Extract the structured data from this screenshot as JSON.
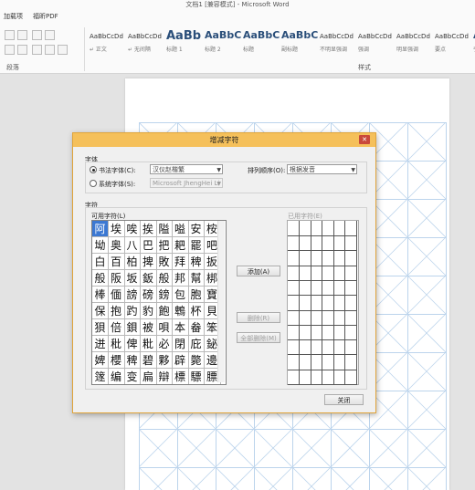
{
  "window": {
    "title": "文档1 [兼容模式] - Microsoft Word"
  },
  "ribbon": {
    "tabs": [
      "加载项",
      "福昕PDF"
    ],
    "groups": {
      "paragraph": "段落",
      "styles": "样式"
    },
    "styles": [
      {
        "preview": "AaBbCcDd",
        "name": "↵ 正文"
      },
      {
        "preview": "AaBbCcDd",
        "name": "↵ 无间隔"
      },
      {
        "preview": "AaBb",
        "name": "标题 1"
      },
      {
        "preview": "AaBbC",
        "name": "标题 2"
      },
      {
        "preview": "AaBbC",
        "name": "标题"
      },
      {
        "preview": "AaBbC",
        "name": "副标题"
      },
      {
        "preview": "AaBbCcDd",
        "name": "不明显强调"
      },
      {
        "preview": "AaBbCcDd",
        "name": "强调"
      },
      {
        "preview": "AaBbCcDd",
        "name": "明显强调"
      },
      {
        "preview": "AaBbCcDd",
        "name": "要点"
      },
      {
        "preview": "AaB",
        "name": "引"
      }
    ]
  },
  "dialog": {
    "title": "增减字符",
    "close_glyph": "✕",
    "font_section": "字体",
    "calligraphy_font_label": "书法字体(C):",
    "calligraphy_font_value": "汉仪赵楷繁",
    "system_font_label": "系统字体(S):",
    "system_font_value": "Microsoft JhengHei Li",
    "sort_label": "排列顺序(O):",
    "sort_value": "根据发音",
    "chars_section": "字符",
    "available_label": "可用字符(L)",
    "used_label": "已用字符(E)",
    "add_button": "添加(A)",
    "delete_button": "删除(R)",
    "delete_all_button": "全部删除(M)",
    "close_button": "关闭",
    "available_chars": [
      [
        "阿",
        "埃",
        "唉",
        "挨",
        "隘",
        "嗌",
        "安",
        "桉"
      ],
      [
        "坳",
        "奥",
        "八",
        "巴",
        "把",
        "耙",
        "罷",
        "吧"
      ],
      [
        "白",
        "百",
        "柏",
        "捭",
        "敗",
        "拜",
        "稗",
        "扳"
      ],
      [
        "般",
        "阪",
        "坂",
        "鈑",
        "般",
        "邦",
        "幫",
        "梆"
      ],
      [
        "棒",
        "偭",
        "謗",
        "磅",
        "鎊",
        "包",
        "胞",
        "寶"
      ],
      [
        "保",
        "抱",
        "趵",
        "豹",
        "飽",
        "鵯",
        "杯",
        "貝"
      ],
      [
        "狽",
        "倍",
        "鋇",
        "被",
        "唄",
        "本",
        "畚",
        "笨"
      ],
      [
        "迸",
        "秕",
        "俾",
        "粃",
        "必",
        "閉",
        "庇",
        "鉍"
      ],
      [
        "婢",
        "櫻",
        "稗",
        "碧",
        "夥",
        "辟",
        "斃",
        "邊"
      ],
      [
        "篴",
        "编",
        "变",
        "扁",
        "辯",
        "標",
        "驃",
        "膘"
      ]
    ]
  },
  "colors": {
    "dialog_title_bar": "#f5c05a",
    "selected_char": "#3c78d2",
    "annotation_arrow": "#e02020",
    "grid_lines": "#bcd4ec"
  }
}
